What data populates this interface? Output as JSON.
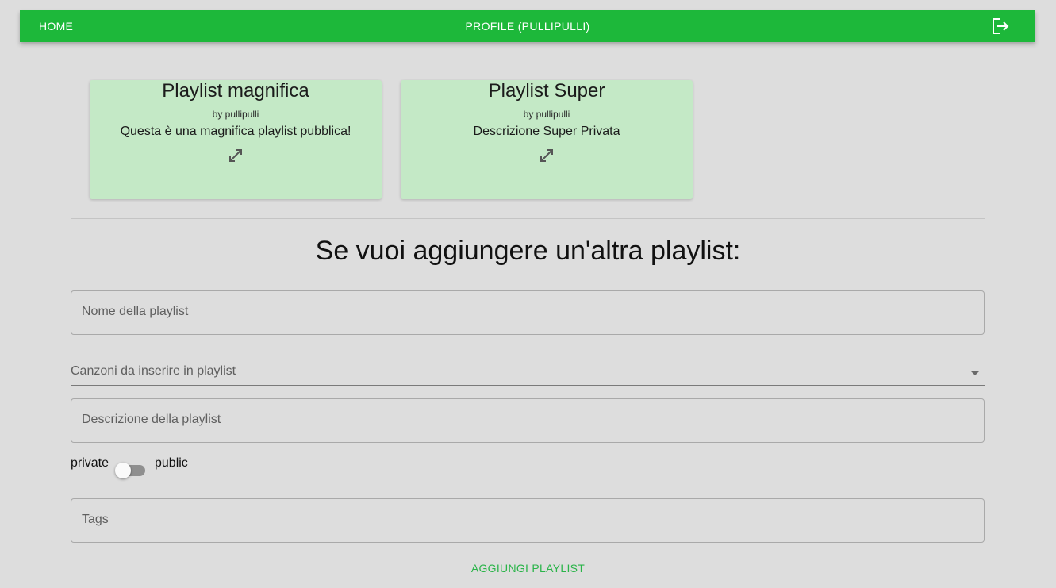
{
  "nav": {
    "home_label": "HOME",
    "profile_label": "PROFILE (PULLIPULLI)",
    "logout_icon": "logout-icon"
  },
  "playlists": [
    {
      "title": "Playlist magnifica",
      "author": "by pullipulli",
      "description": "Questa è una magnifica playlist pubblica!",
      "icon": "expand-icon"
    },
    {
      "title": "Playlist Super",
      "author": "by pullipulli",
      "description": "Descrizione Super Privata",
      "icon": "expand-icon"
    }
  ],
  "form": {
    "heading": "Se vuoi aggiungere un'altra playlist:",
    "name_placeholder": "Nome della playlist",
    "name_value": "",
    "songs_placeholder": "Canzoni da inserire in playlist",
    "description_placeholder": "Descrizione della playlist",
    "description_value": "",
    "visibility_private_label": "private",
    "visibility_public_label": "public",
    "visibility_is_public": false,
    "tags_placeholder": "Tags",
    "tags_value": "",
    "submit_label": "AGGIUNGI PLAYLIST"
  },
  "colors": {
    "accent": "#1db83a",
    "card_background": "#c4e9c6",
    "page_background": "#dddddd",
    "submit_text": "#2ab449"
  }
}
